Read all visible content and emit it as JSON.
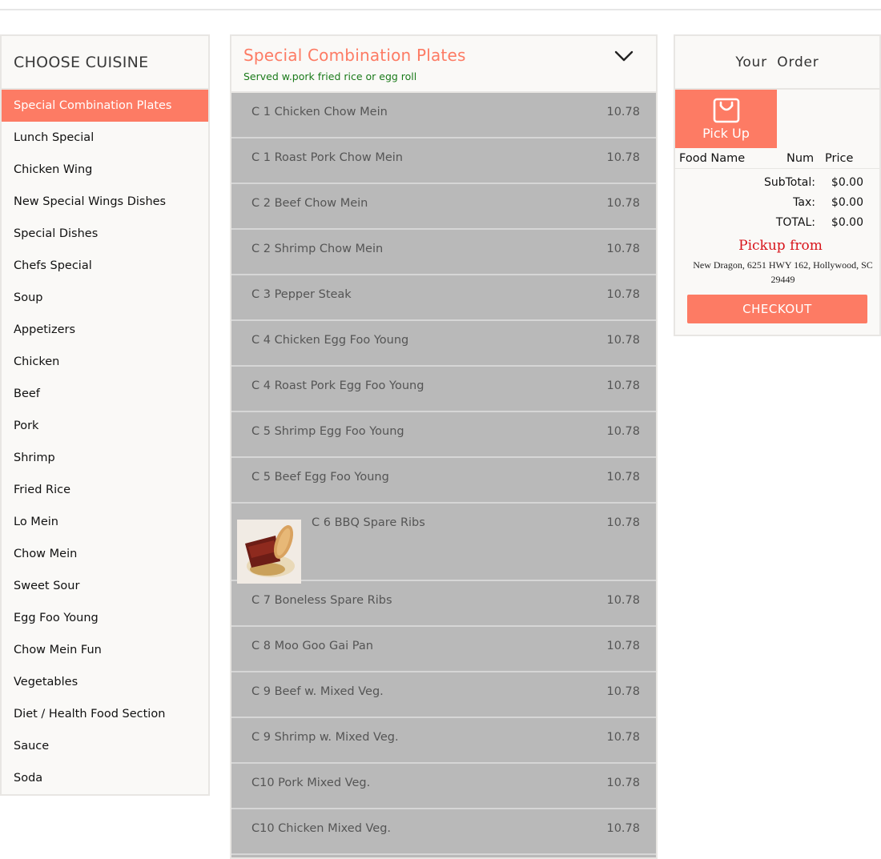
{
  "sidebar": {
    "title": "CHOOSE CUISINE",
    "items": [
      "Special Combination Plates",
      "Lunch Special",
      "Chicken Wing",
      "New Special Wings Dishes",
      "Special Dishes",
      "Chefs Special",
      "Soup",
      "Appetizers",
      "Chicken",
      "Beef",
      "Pork",
      "Shrimp",
      "Fried Rice",
      "Lo Mein",
      "Chow Mein",
      "Sweet Sour",
      "Egg Foo Young",
      "Chow Mein Fun",
      "Vegetables",
      "Diet / Health Food Section",
      "Sauce",
      "Soda"
    ],
    "active_index": 0
  },
  "menu": {
    "title": "Special Combination Plates",
    "subtitle": "Served w.pork fried rice or egg roll",
    "items": [
      {
        "name": "C 1 Chicken Chow Mein",
        "price": "10.78"
      },
      {
        "name": "C 1 Roast Pork Chow Mein",
        "price": "10.78"
      },
      {
        "name": "C 2 Beef Chow Mein",
        "price": "10.78"
      },
      {
        "name": "C 2 Shrimp Chow Mein",
        "price": "10.78"
      },
      {
        "name": "C 3 Pepper Steak",
        "price": "10.78"
      },
      {
        "name": "C 4 Chicken Egg Foo Young",
        "price": "10.78"
      },
      {
        "name": "C 4 Roast Pork Egg Foo Young",
        "price": "10.78"
      },
      {
        "name": "C 5 Shrimp Egg Foo Young",
        "price": "10.78"
      },
      {
        "name": "C 5 Beef Egg Foo Young",
        "price": "10.78"
      },
      {
        "name": "C 6 BBQ Spare Ribs",
        "price": "10.78",
        "has_image": true
      },
      {
        "name": "C 7 Boneless Spare Ribs",
        "price": "10.78"
      },
      {
        "name": "C 8 Moo Goo Gai Pan",
        "price": "10.78"
      },
      {
        "name": "C 9 Beef w. Mixed Veg.",
        "price": "10.78"
      },
      {
        "name": "C 9 Shrimp w. Mixed Veg.",
        "price": "10.78"
      },
      {
        "name": "C10 Pork Mixed Veg.",
        "price": "10.78"
      },
      {
        "name": "C10 Chicken Mixed Veg.",
        "price": "10.78"
      }
    ]
  },
  "order": {
    "title": "Your  Order",
    "pickup_label": "Pick Up",
    "columns": {
      "food": "Food Name",
      "num": "Num",
      "price": "Price"
    },
    "subtotal_label": "SubTotal:",
    "subtotal": "$0.00",
    "tax_label": "Tax:",
    "tax": "$0.00",
    "total_label": "TOTAL:",
    "total": "$0.00",
    "pickup_from": "Pickup from",
    "address": "New Dragon, 6251 HWY 162, Hollywood, SC 29449",
    "checkout_label": "CHECKOUT"
  },
  "colors": {
    "accent": "#fd7b64",
    "subtitle_green": "#1a7a1a",
    "pickup_red": "#d8141b",
    "menu_item_bg": "#b9b9b9",
    "panel_bg": "#faf9f7"
  },
  "icons": {
    "menu_toggle": "chevron-down-icon",
    "pickup": "shopping-bag-icon",
    "item_image": "bbq-ribs-photo"
  }
}
